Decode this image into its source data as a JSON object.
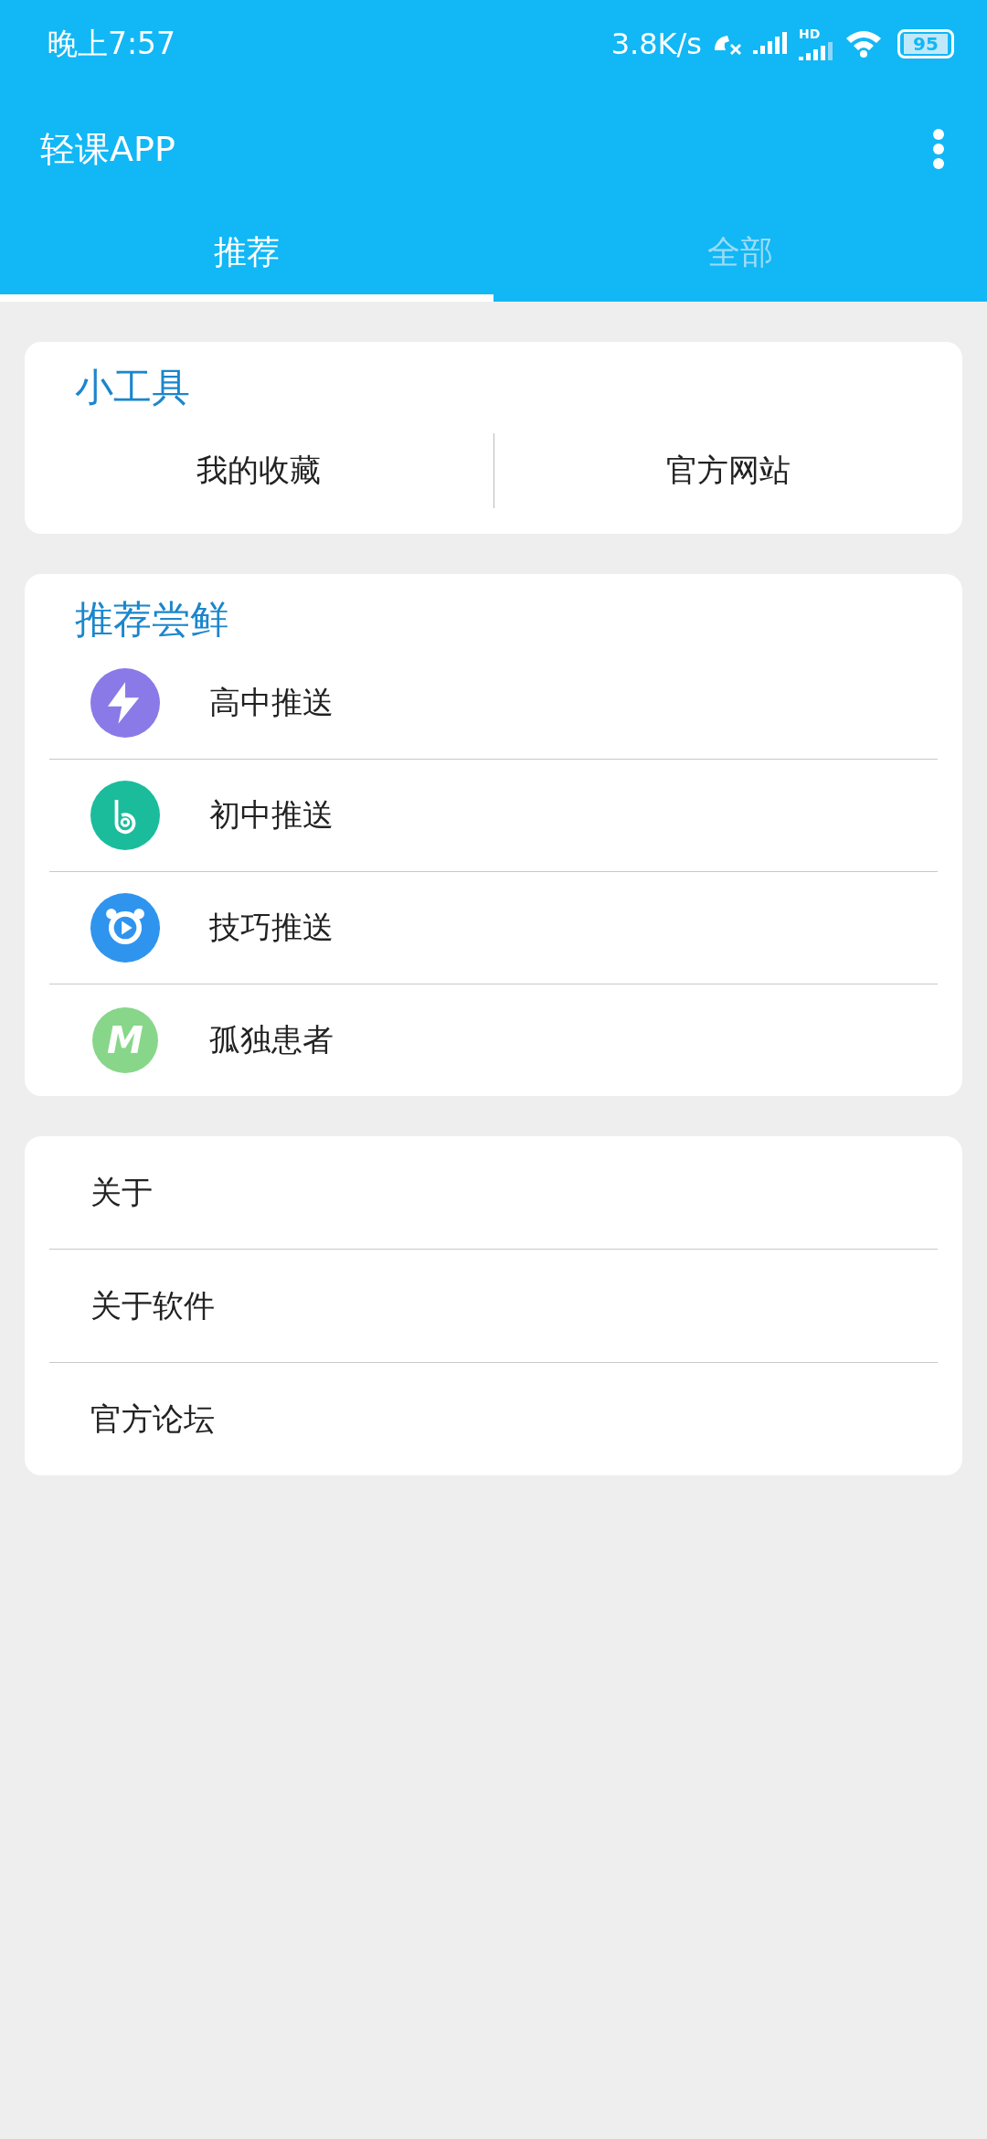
{
  "status_bar": {
    "time": "晚上7:57",
    "net_speed": "3.8K/s",
    "hd": "HD",
    "battery": "95"
  },
  "app_bar": {
    "title": "轻课APP"
  },
  "tabs": [
    {
      "label": "推荐",
      "selected": true
    },
    {
      "label": "全部",
      "selected": false
    }
  ],
  "tools": {
    "title": "小工具",
    "items": [
      "我的收藏",
      "官方网站"
    ]
  },
  "recommend": {
    "title": "推荐尝鲜",
    "items": [
      {
        "label": "高中推送",
        "kind": "bolt",
        "color": "#8a7ae8"
      },
      {
        "label": "初中推送",
        "kind": "b",
        "color": "#1abc9c"
      },
      {
        "label": "技巧推送",
        "kind": "play",
        "color": "#2f94ee"
      },
      {
        "label": "孤独患者",
        "kind": "letter",
        "icon_text": "M",
        "color": "#88d68a"
      }
    ]
  },
  "links": [
    "关于",
    "关于软件",
    "官方论坛"
  ]
}
